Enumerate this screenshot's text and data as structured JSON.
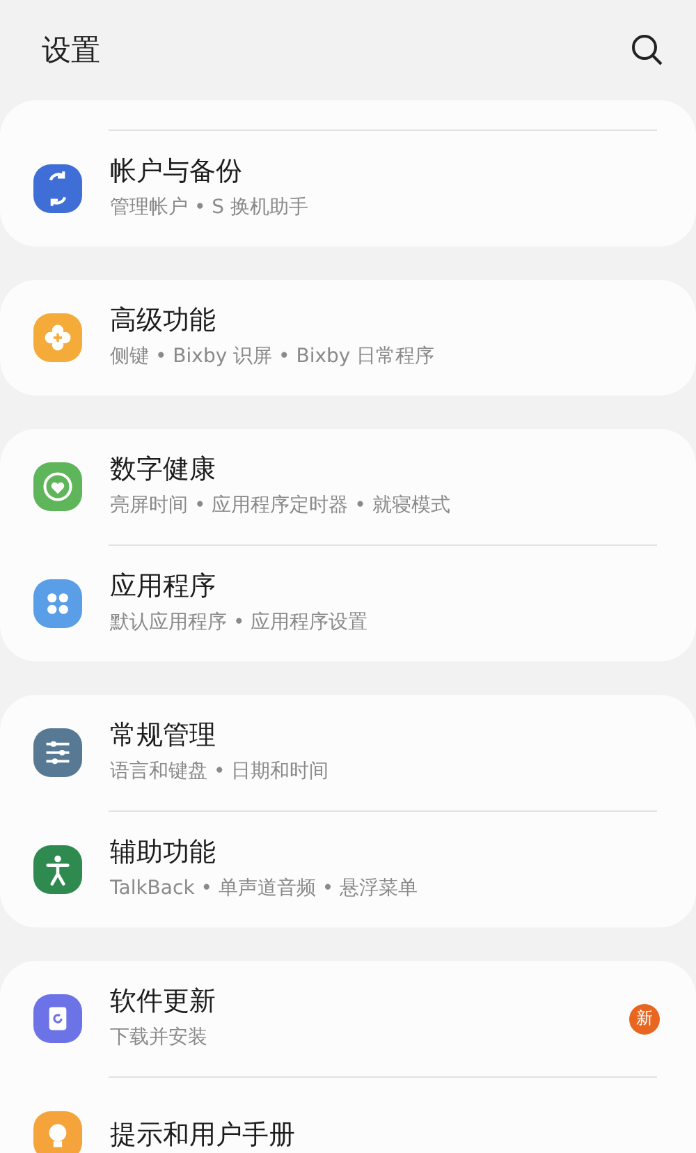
{
  "header": {
    "title": "设置"
  },
  "cards": [
    {
      "rows": [
        {
          "title": "帐户与备份",
          "subtitle": "管理帐户 • S 换机助手"
        }
      ]
    },
    {
      "rows": [
        {
          "title": "高级功能",
          "subtitle": "侧键 • Bixby 识屏 • Bixby 日常程序"
        }
      ]
    },
    {
      "rows": [
        {
          "title": "数字健康",
          "subtitle": "亮屏时间 • 应用程序定时器 • 就寝模式"
        },
        {
          "title": "应用程序",
          "subtitle": "默认应用程序 • 应用程序设置"
        }
      ]
    },
    {
      "rows": [
        {
          "title": "常规管理",
          "subtitle": "语言和键盘 • 日期和时间"
        },
        {
          "title": "辅助功能",
          "subtitle": "TalkBack • 单声道音频 • 悬浮菜单"
        }
      ]
    },
    {
      "rows": [
        {
          "title": "软件更新",
          "subtitle": "下载并安装",
          "badge": "新"
        },
        {
          "title": "提示和用户手册"
        }
      ]
    }
  ]
}
